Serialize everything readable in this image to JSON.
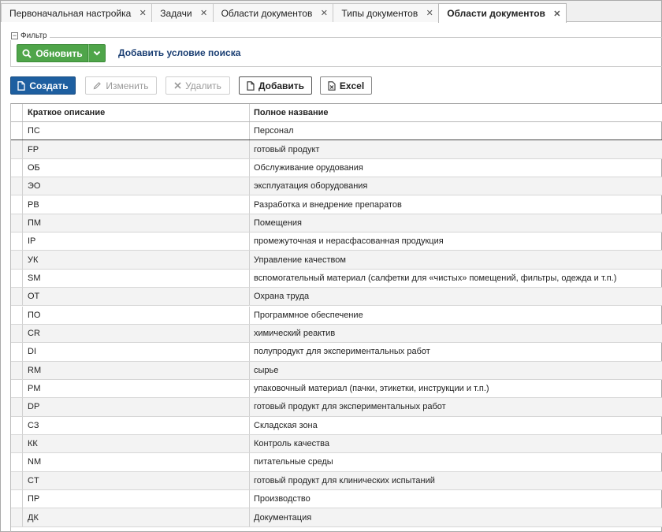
{
  "tabs": [
    {
      "label": "Первоначальная настройка",
      "active": false
    },
    {
      "label": "Задачи",
      "active": false
    },
    {
      "label": "Области документов",
      "active": false
    },
    {
      "label": "Типы документов",
      "active": false
    },
    {
      "label": "Области документов",
      "active": true
    }
  ],
  "filter": {
    "legend": "Фильтр",
    "refresh_label": "Обновить",
    "add_condition": "Добавить условие поиска"
  },
  "toolbar": {
    "create": "Создать",
    "edit": "Изменить",
    "delete": "Удалить",
    "add": "Добавить",
    "excel": "Excel"
  },
  "colors": {
    "primary": "#1e5fa0",
    "success": "#4fa54a",
    "link": "#1b3f73"
  },
  "table": {
    "columns": [
      "Краткое описание",
      "Полное название"
    ],
    "rows": [
      [
        "ПС",
        "Персонал"
      ],
      [
        "FP",
        "готовый продукт"
      ],
      [
        "ОБ",
        "Обслуживание орудования"
      ],
      [
        "ЭО",
        "эксплуатация оборудования"
      ],
      [
        "РВ",
        "Разработка и внедрение препаратов"
      ],
      [
        "ПМ",
        "Помещения"
      ],
      [
        "IP",
        "промежуточная и нерасфасованная продукция"
      ],
      [
        "УК",
        "Управление качеством"
      ],
      [
        "SM",
        "вспомогательный материал (салфетки для «чистых» помещений, фильтры, одежда и т.п.)"
      ],
      [
        "ОТ",
        "Охрана труда"
      ],
      [
        "ПО",
        "Программное обеспечение"
      ],
      [
        "CR",
        "химический реактив"
      ],
      [
        "DI",
        "полупродукт для экспериментальных работ"
      ],
      [
        "RM",
        "сырье"
      ],
      [
        "PM",
        "упаковочный материал (пачки, этикетки, инструкции и т.п.)"
      ],
      [
        "DP",
        "готовый продукт для экспериментальных работ"
      ],
      [
        "СЗ",
        "Складская зона"
      ],
      [
        "КК",
        "Контроль качества"
      ],
      [
        "NM",
        "питательные среды"
      ],
      [
        "CT",
        "готовый продукт для клинических испытаний"
      ],
      [
        "ПР",
        "Производство"
      ],
      [
        "ДК",
        "Документация"
      ]
    ]
  }
}
